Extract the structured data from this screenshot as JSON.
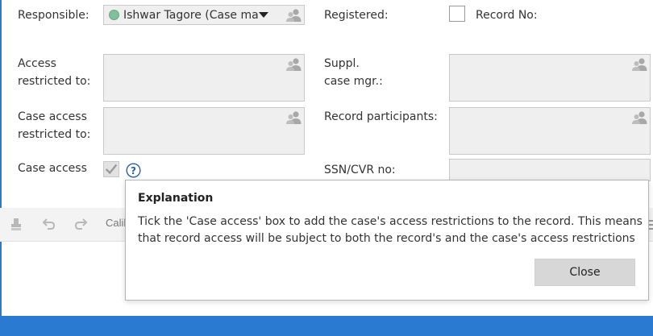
{
  "form": {
    "responsible_label": "Responsible:",
    "responsible_value": "Ishwar Tagore (Case manager)",
    "responsible_status_color": "#7fbf99",
    "registered_label": "Registered:",
    "record_no_label": "Record No:",
    "access_restricted_label_line1": "Access",
    "access_restricted_label_line2": "restricted to:",
    "suppl_case_mgr_label_line1": "Suppl.",
    "suppl_case_mgr_label_line2": "case mgr.:",
    "case_access_restricted_label_line1": "Case access",
    "case_access_restricted_label_line2": "restricted to:",
    "record_participants_label": "Record participants:",
    "case_access_label": "Case access",
    "case_access_checked": true,
    "ssn_cvr_label": "SSN/CVR no:",
    "ssn_cvr_value": ""
  },
  "toolbar": {
    "font_name": "Calil",
    "icons": [
      "format-painter-icon",
      "undo-icon",
      "redo-icon"
    ]
  },
  "dialog": {
    "title": "Explanation",
    "text": "Tick the 'Case access' box to add the case's access restrictions to the record. This means that record access will be subject to both the record's and the case's access restrictions",
    "close_label": "Close"
  },
  "colors": {
    "accent": "#2a7ad2",
    "field_bg": "#efefef",
    "button_bg": "#d7d7d7"
  }
}
